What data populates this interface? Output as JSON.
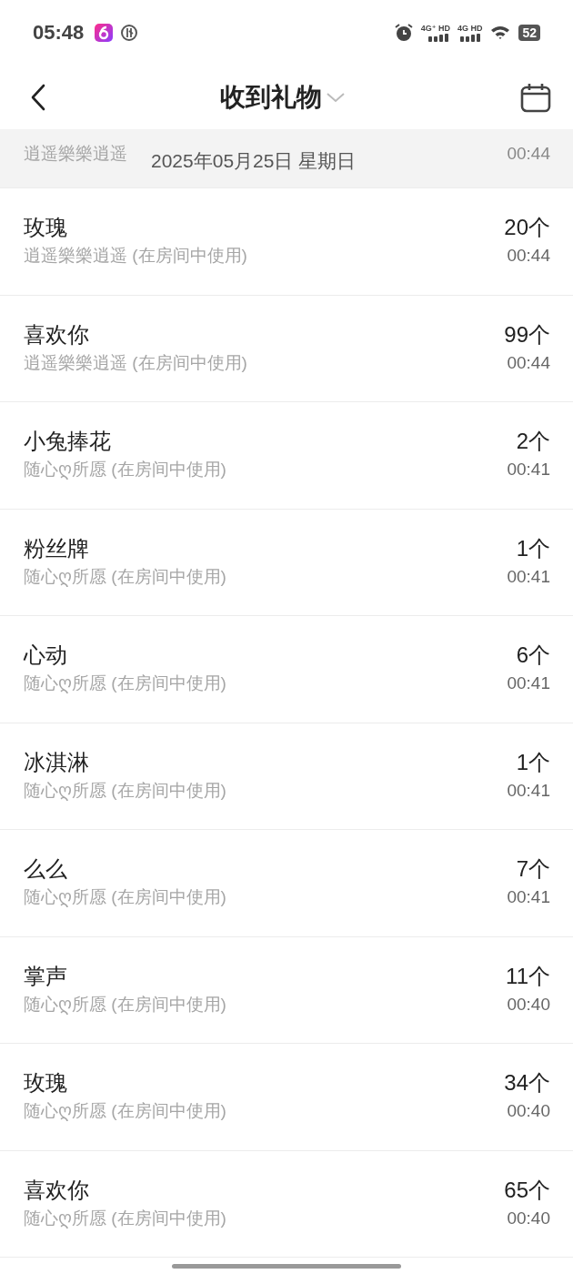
{
  "status_bar": {
    "time": "05:48",
    "networks": [
      {
        "label": "4G⁺ HD"
      },
      {
        "label": "4G HD"
      }
    ],
    "battery": "52"
  },
  "header": {
    "title": "收到礼物"
  },
  "date_header": {
    "date": "2025年05月25日 星期日",
    "peek_row": {
      "subtitle": "逍遥樂樂逍遥",
      "time": "00:44"
    }
  },
  "gifts": [
    {
      "name": "玫瑰",
      "sender": "逍遥樂樂逍遥 (在房间中使用)",
      "count": "20个",
      "time": "00:44"
    },
    {
      "name": "喜欢你",
      "sender": "逍遥樂樂逍遥 (在房间中使用)",
      "count": "99个",
      "time": "00:44"
    },
    {
      "name": "小兔捧花",
      "sender": "随心ღ所愿 (在房间中使用)",
      "count": "2个",
      "time": "00:41"
    },
    {
      "name": "粉丝牌",
      "sender": "随心ღ所愿 (在房间中使用)",
      "count": "1个",
      "time": "00:41"
    },
    {
      "name": "心动",
      "sender": "随心ღ所愿 (在房间中使用)",
      "count": "6个",
      "time": "00:41"
    },
    {
      "name": "冰淇淋",
      "sender": "随心ღ所愿 (在房间中使用)",
      "count": "1个",
      "time": "00:41"
    },
    {
      "name": "么么",
      "sender": "随心ღ所愿 (在房间中使用)",
      "count": "7个",
      "time": "00:41"
    },
    {
      "name": "掌声",
      "sender": "随心ღ所愿 (在房间中使用)",
      "count": "11个",
      "time": "00:40"
    },
    {
      "name": "玫瑰",
      "sender": "随心ღ所愿 (在房间中使用)",
      "count": "34个",
      "time": "00:40"
    },
    {
      "name": "喜欢你",
      "sender": "随心ღ所愿 (在房间中使用)",
      "count": "65个",
      "time": "00:40"
    }
  ]
}
